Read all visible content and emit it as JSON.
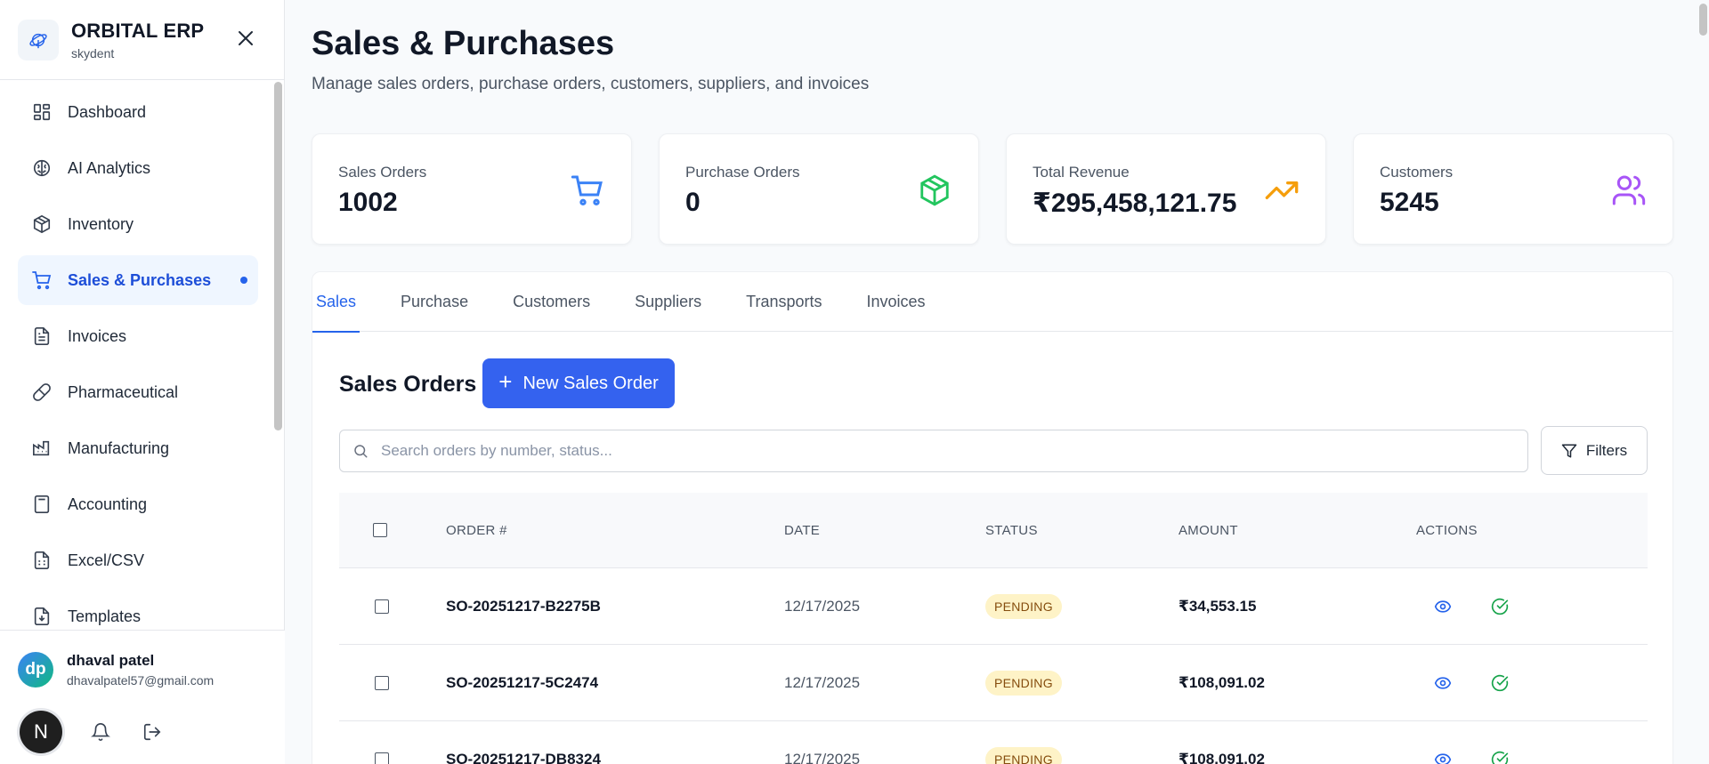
{
  "brand": {
    "name": "ORBITAL ERP",
    "subtitle": "skydent"
  },
  "sidebar": {
    "items": [
      {
        "label": "Dashboard",
        "icon": "dashboard-icon"
      },
      {
        "label": "AI Analytics",
        "icon": "brain-icon"
      },
      {
        "label": "Inventory",
        "icon": "package-icon"
      },
      {
        "label": "Sales & Purchases",
        "icon": "cart-icon",
        "active": true
      },
      {
        "label": "Invoices",
        "icon": "document-icon"
      },
      {
        "label": "Pharmaceutical",
        "icon": "pill-icon"
      },
      {
        "label": "Manufacturing",
        "icon": "factory-icon"
      },
      {
        "label": "Accounting",
        "icon": "calculator-icon"
      },
      {
        "label": "Excel/CSV",
        "icon": "spreadsheet-icon"
      },
      {
        "label": "Templates",
        "icon": "file-download-icon"
      }
    ]
  },
  "user": {
    "initials": "dp",
    "name": "dhaval patel",
    "email": "dhavalpatel57@gmail.com",
    "badge": "N"
  },
  "page": {
    "title": "Sales & Purchases",
    "subtitle": "Manage sales orders, purchase orders, customers, suppliers, and invoices"
  },
  "stats": [
    {
      "label": "Sales Orders",
      "value": "1002",
      "icon": "cart-icon",
      "color": "#3b82f6"
    },
    {
      "label": "Purchase Orders",
      "value": "0",
      "icon": "package-icon",
      "color": "#22c55e"
    },
    {
      "label": "Total Revenue",
      "value": "₹295,458,121.75",
      "icon": "trending-up-icon",
      "color": "#f59e0b"
    },
    {
      "label": "Customers",
      "value": "5245",
      "icon": "users-icon",
      "color": "#a855f7"
    }
  ],
  "tabs": [
    "Sales",
    "Purchase",
    "Customers",
    "Suppliers",
    "Transports",
    "Invoices"
  ],
  "sales": {
    "title": "Sales Orders",
    "new_button": "New Sales Order",
    "search_placeholder": "Search orders by number, status...",
    "filters_label": "Filters",
    "columns": [
      "ORDER #",
      "DATE",
      "STATUS",
      "AMOUNT",
      "ACTIONS"
    ],
    "rows": [
      {
        "order": "SO-20251217-B2275B",
        "date": "12/17/2025",
        "status": "PENDING",
        "amount": "₹34,553.15"
      },
      {
        "order": "SO-20251217-5C2474",
        "date": "12/17/2025",
        "status": "PENDING",
        "amount": "₹108,091.02"
      },
      {
        "order": "SO-20251217-DB8324",
        "date": "12/17/2025",
        "status": "PENDING",
        "amount": "₹108,091.02"
      }
    ]
  },
  "colors": {
    "accent": "#2563eb",
    "button": "#3462ef",
    "pending_bg": "#fef3c7",
    "pending_text": "#854d0e"
  }
}
